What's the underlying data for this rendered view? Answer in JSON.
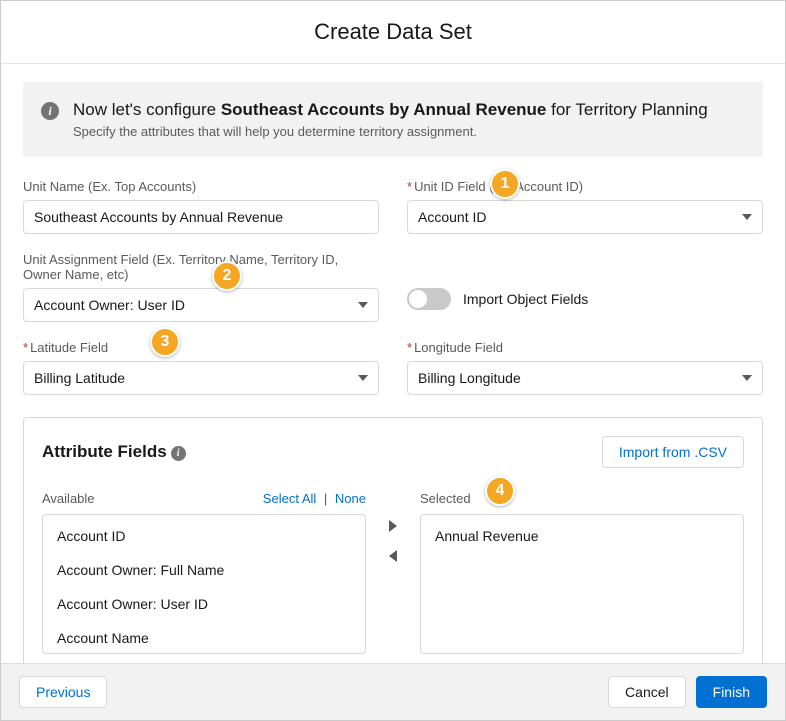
{
  "header": {
    "title": "Create Data Set"
  },
  "info": {
    "prefix": "Now let's configure ",
    "bold": "Southeast Accounts by Annual Revenue",
    "suffix": " for Territory Planning",
    "subtitle": "Specify the attributes that will help you determine territory assignment."
  },
  "fields": {
    "unitName": {
      "label": "Unit Name (Ex. Top Accounts)",
      "value": "Southeast Accounts by Annual Revenue"
    },
    "unitIdField": {
      "label": "Unit ID Field (Ex. Account ID)",
      "value": "Account ID"
    },
    "unitAssignment": {
      "label": "Unit Assignment Field (Ex. Territory Name, Territory ID, Owner Name, etc)",
      "value": "Account Owner: User ID"
    },
    "importObject": {
      "label": "Import Object Fields"
    },
    "latitude": {
      "label": "Latitude Field",
      "value": "Billing Latitude"
    },
    "longitude": {
      "label": "Longitude Field",
      "value": "Billing Longitude"
    }
  },
  "attributes": {
    "title": "Attribute Fields",
    "importButton": "Import from .CSV",
    "availableLabel": "Available",
    "selectedLabel": "Selected",
    "selectAll": "Select All",
    "none": "None",
    "available": [
      "Account ID",
      "Account Owner: Full Name",
      "Account Owner: User ID",
      "Account Name"
    ],
    "selected": [
      "Annual Revenue"
    ]
  },
  "footer": {
    "previous": "Previous",
    "cancel": "Cancel",
    "finish": "Finish"
  },
  "callouts": {
    "c1": "1",
    "c2": "2",
    "c3": "3",
    "c4": "4"
  }
}
